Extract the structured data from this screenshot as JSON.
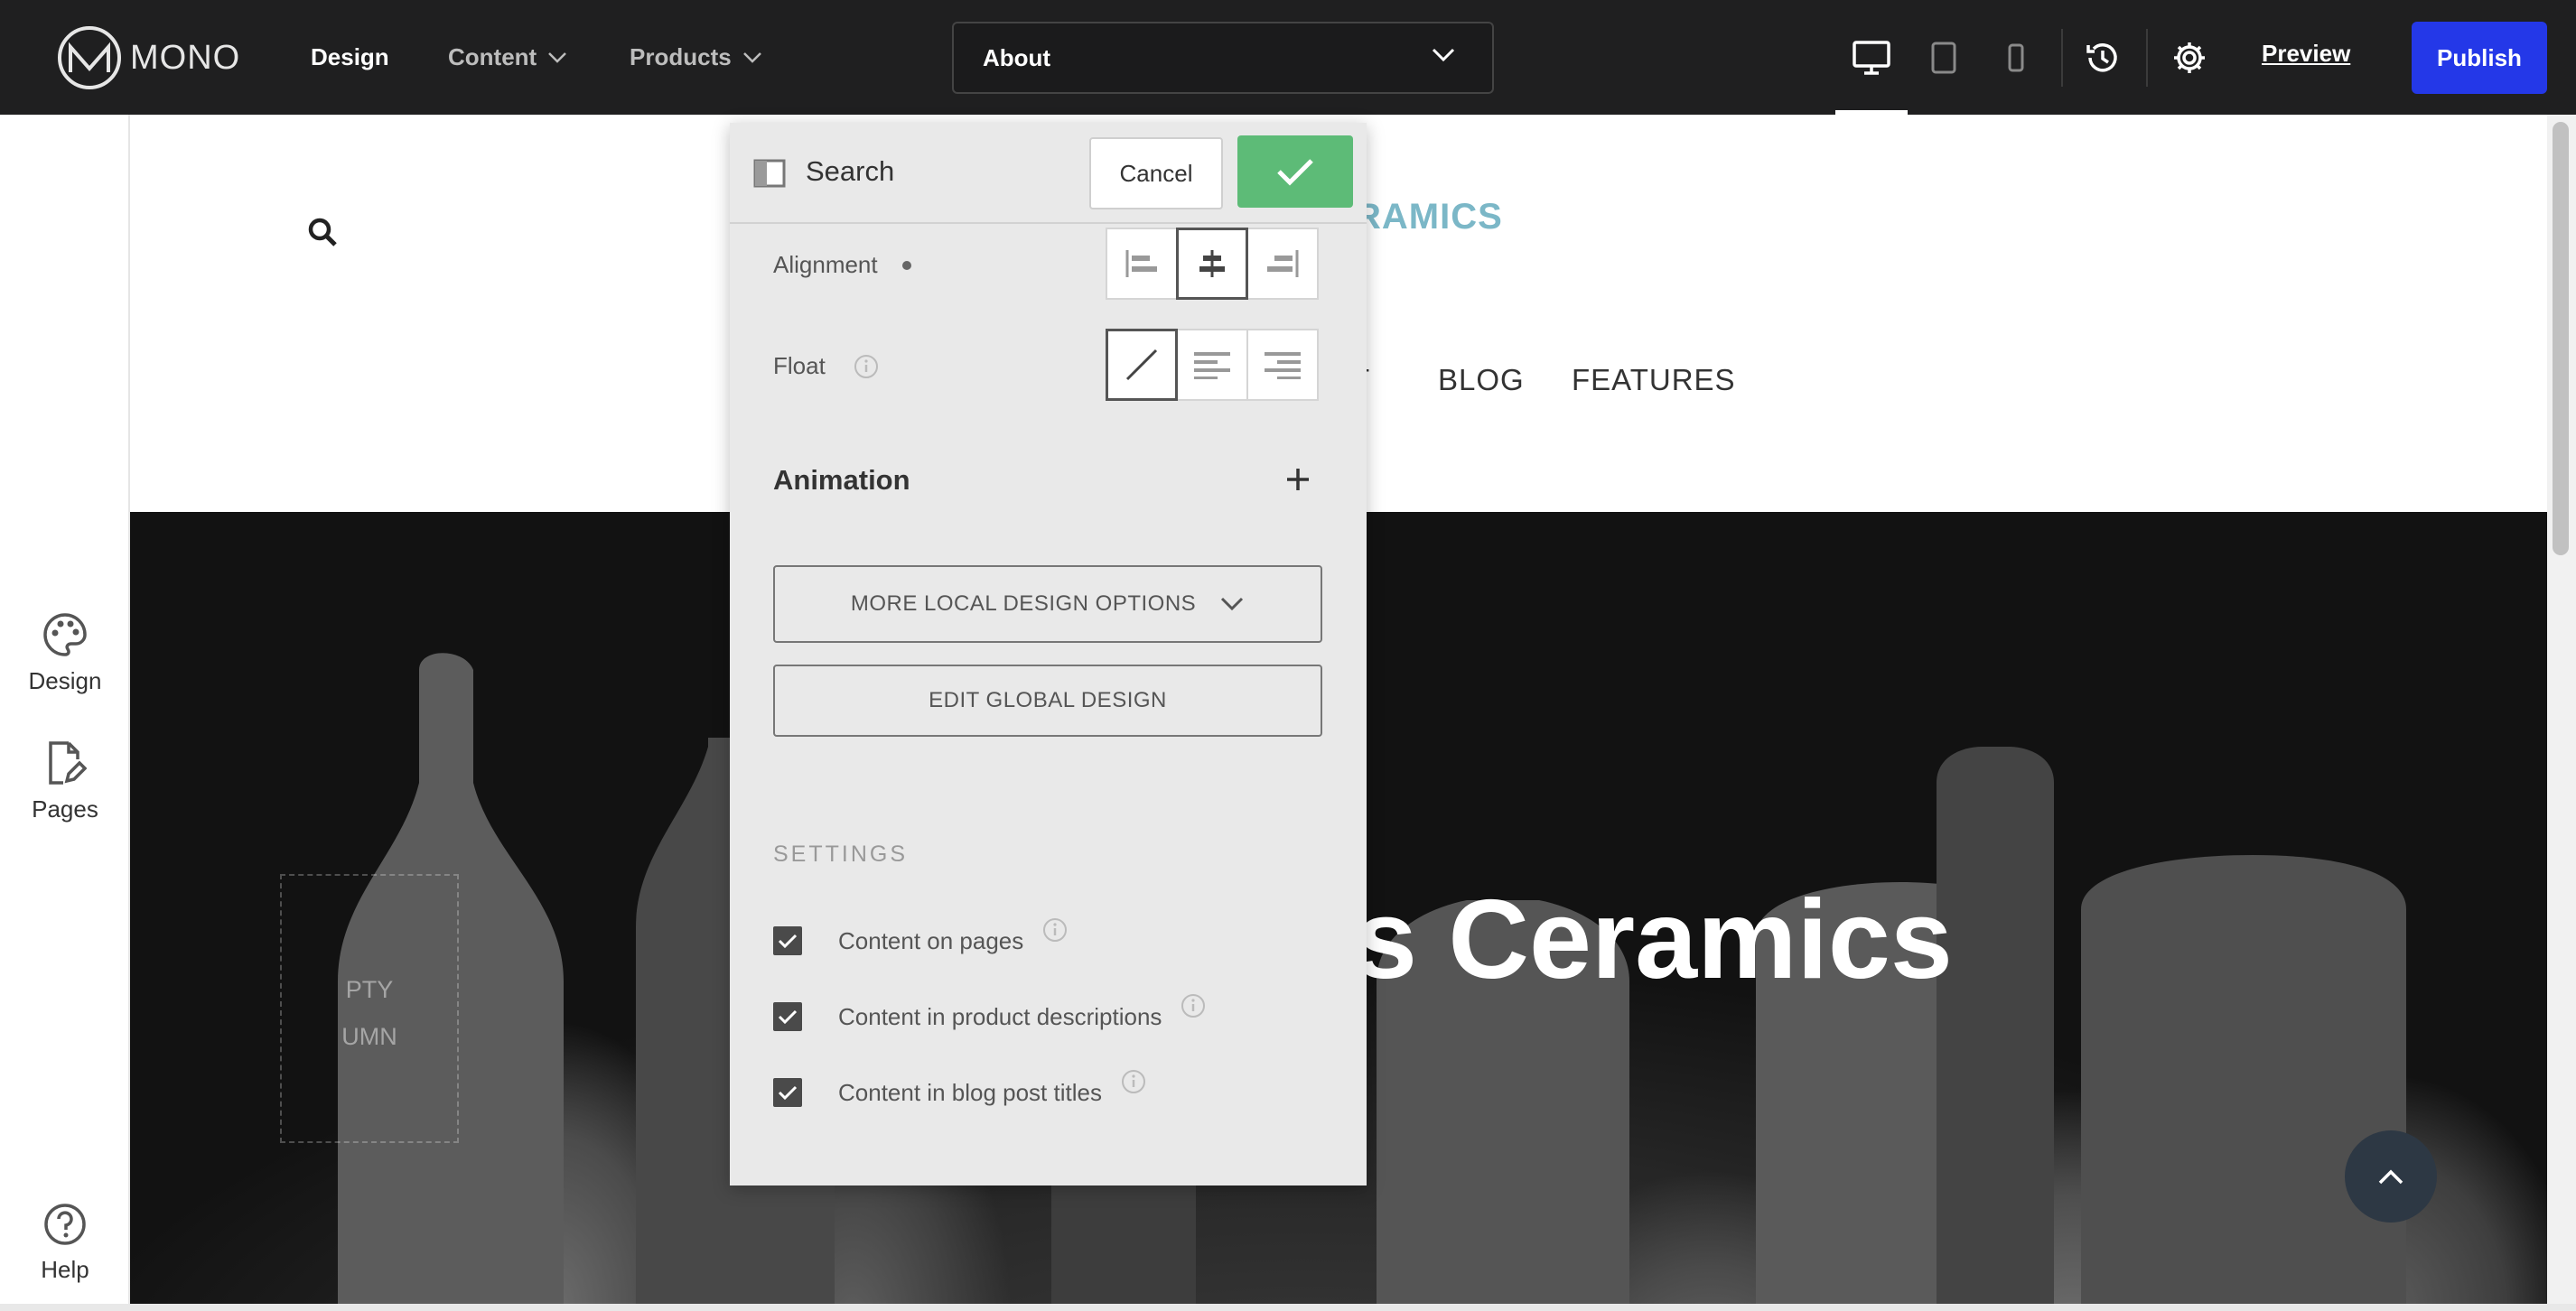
{
  "topbar": {
    "logo_text": "MONO",
    "nav": {
      "design": "Design",
      "content": "Content",
      "products": "Products"
    },
    "page_select_value": "About",
    "preview_label": "Preview",
    "publish_label": "Publish"
  },
  "sidebar": {
    "design_label": "Design",
    "pages_label": "Pages",
    "help_label": "Help"
  },
  "site": {
    "brand_partial": "RAMICS",
    "nav": [
      "T",
      "BLOG",
      "FEATURES"
    ],
    "hero_title_partial": "s Ceramics",
    "empty_column_line1": "PTY",
    "empty_column_line2": "UMN"
  },
  "panel": {
    "title": "Search",
    "cancel_label": "Cancel",
    "alignment_label": "Alignment",
    "float_label": "Float",
    "animation_label": "Animation",
    "more_options_label": "MORE LOCAL DESIGN OPTIONS",
    "edit_global_label": "EDIT GLOBAL DESIGN",
    "settings_heading": "SETTINGS",
    "checkboxes": [
      {
        "label": "Content on pages",
        "checked": true
      },
      {
        "label": "Content in product descriptions",
        "checked": true
      },
      {
        "label": "Content in blog post titles",
        "checked": true
      }
    ]
  },
  "colors": {
    "topbar_bg": "#1f1f20",
    "publish": "#2438e8",
    "confirm": "#5dbb77",
    "brand_accent": "#7bb7c7"
  }
}
